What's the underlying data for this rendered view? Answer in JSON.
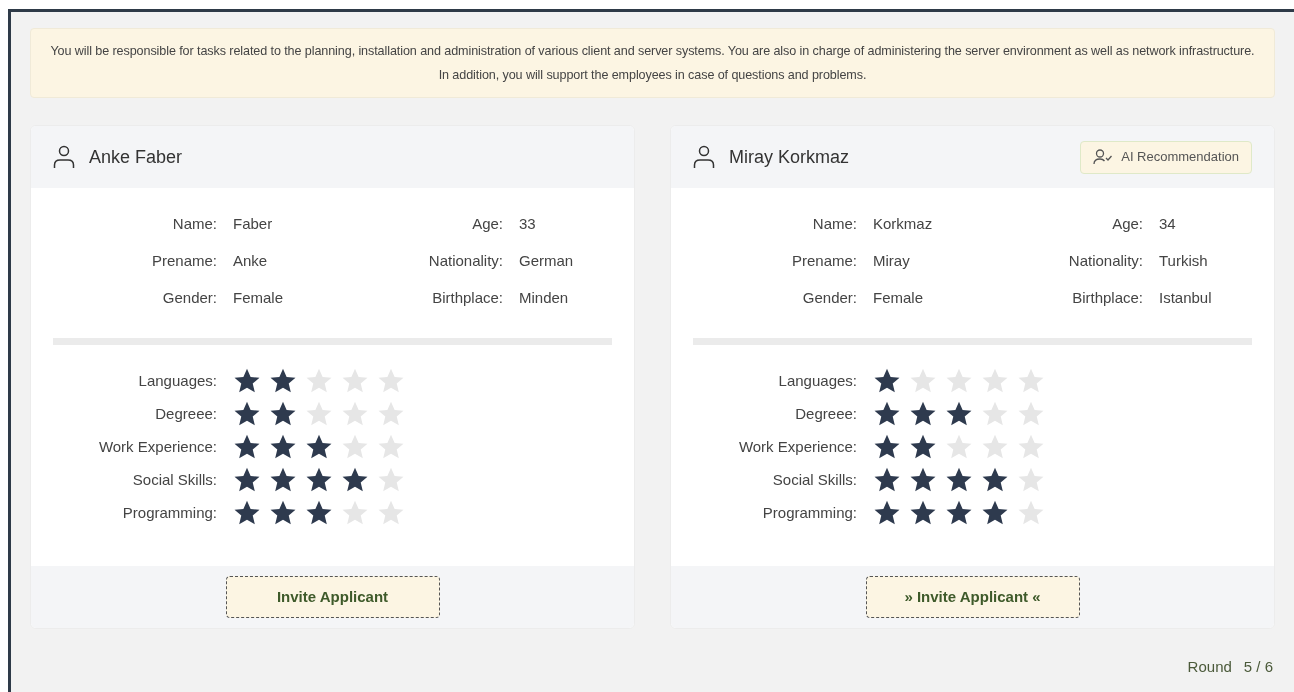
{
  "description": "You will be responsible for tasks related to the planning, installation and administration of various client and server systems. You are also in charge of administering the server environment as well as network infrastructure. In addition, you will support the employees in case of questions and problems.",
  "applicants": [
    {
      "full_name": "Anke Faber",
      "info": [
        {
          "label": "Name:",
          "value": "Faber"
        },
        {
          "label": "Age:",
          "value": "33"
        },
        {
          "label": "Prename:",
          "value": "Anke"
        },
        {
          "label": "Nationality:",
          "value": "German"
        },
        {
          "label": "Gender:",
          "value": "Female"
        },
        {
          "label": "Birthplace:",
          "value": "Minden"
        }
      ],
      "skills": [
        {
          "label": "Languages:",
          "stars": 2
        },
        {
          "label": "Degreee:",
          "stars": 2
        },
        {
          "label": "Work Experience:",
          "stars": 3
        },
        {
          "label": "Social Skills:",
          "stars": 4
        },
        {
          "label": "Programming:",
          "stars": 3
        }
      ],
      "button": "Invite Applicant"
    },
    {
      "full_name": "Miray Korkmaz",
      "badge": "AI Recommendation",
      "info": [
        {
          "label": "Name:",
          "value": "Korkmaz"
        },
        {
          "label": "Age:",
          "value": "34"
        },
        {
          "label": "Prename:",
          "value": "Miray"
        },
        {
          "label": "Nationality:",
          "value": "Turkish"
        },
        {
          "label": "Gender:",
          "value": "Female"
        },
        {
          "label": "Birthplace:",
          "value": "Istanbul"
        }
      ],
      "skills": [
        {
          "label": "Languages:",
          "stars": 1
        },
        {
          "label": "Degreee:",
          "stars": 3
        },
        {
          "label": "Work Experience:",
          "stars": 2
        },
        {
          "label": "Social Skills:",
          "stars": 4
        },
        {
          "label": "Programming:",
          "stars": 4
        }
      ],
      "button": "» Invite Applicant «"
    }
  ],
  "round": {
    "label": "Round",
    "value": "5 / 6"
  }
}
